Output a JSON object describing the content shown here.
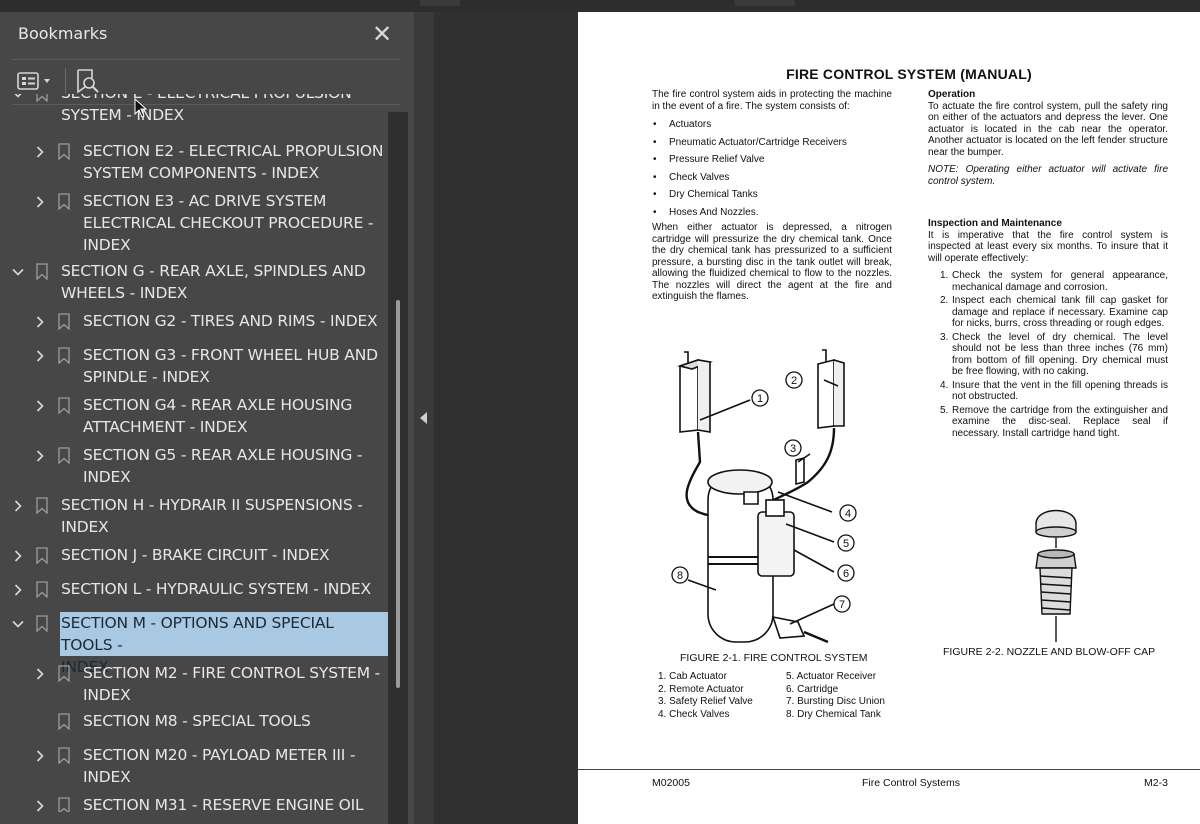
{
  "panel": {
    "title": "Bookmarks",
    "close_glyph": "✕",
    "toolbar": {
      "options_icon": "list-options-icon",
      "find_icon": "find-bookmark-icon"
    }
  },
  "bookmarks": [
    {
      "label_lines": [
        "SECTION E - ELECTRICAL PROPULSION",
        "SYSTEM - INDEX"
      ],
      "indent": 0,
      "expanded": true,
      "chevron": true,
      "clipped": true
    },
    {
      "label_lines": [
        "SECTION E2 - ELECTRICAL PROPULSION",
        "SYSTEM COMPONENTS - INDEX"
      ],
      "indent": 1,
      "expanded": false,
      "chevron": true
    },
    {
      "label_lines": [
        "SECTION E3 - AC DRIVE SYSTEM",
        "ELECTRICAL CHECKOUT PROCEDURE -",
        "INDEX"
      ],
      "indent": 1,
      "expanded": false,
      "chevron": true
    },
    {
      "label_lines": [
        "SECTION G - REAR AXLE, SPINDLES AND",
        "WHEELS - INDEX"
      ],
      "indent": 0,
      "expanded": true,
      "chevron": true
    },
    {
      "label_lines": [
        "SECTION G2 - TIRES AND RIMS - INDEX"
      ],
      "indent": 1,
      "expanded": false,
      "chevron": true
    },
    {
      "label_lines": [
        "SECTION G3 - FRONT WHEEL HUB AND",
        "SPINDLE - INDEX"
      ],
      "indent": 1,
      "expanded": false,
      "chevron": true
    },
    {
      "label_lines": [
        "SECTION G4 - REAR AXLE HOUSING",
        "ATTACHMENT - INDEX"
      ],
      "indent": 1,
      "expanded": false,
      "chevron": true
    },
    {
      "label_lines": [
        "SECTION G5 - REAR AXLE HOUSING -",
        "INDEX"
      ],
      "indent": 1,
      "expanded": false,
      "chevron": true
    },
    {
      "label_lines": [
        "SECTION H - HYDRAIR II SUSPENSIONS -",
        "INDEX"
      ],
      "indent": 0,
      "expanded": false,
      "chevron": true
    },
    {
      "label_lines": [
        "SECTION J - BRAKE CIRCUIT - INDEX"
      ],
      "indent": 0,
      "expanded": false,
      "chevron": true
    },
    {
      "label_lines": [
        "SECTION L - HYDRAULIC SYSTEM - INDEX"
      ],
      "indent": 0,
      "expanded": false,
      "chevron": true
    },
    {
      "label_lines": [
        "SECTION M - OPTIONS AND SPECIAL TOOLS -",
        "INDEX"
      ],
      "indent": 0,
      "expanded": true,
      "chevron": true,
      "selected": true
    },
    {
      "label_lines": [
        "SECTION M2 - FIRE CONTROL SYSTEM -",
        "INDEX"
      ],
      "indent": 1,
      "expanded": false,
      "chevron": true
    },
    {
      "label_lines": [
        "SECTION M8 - SPECIAL TOOLS"
      ],
      "indent": 1,
      "expanded": false,
      "chevron": false
    },
    {
      "label_lines": [
        "SECTION M20 - PAYLOAD METER III -",
        "INDEX"
      ],
      "indent": 1,
      "expanded": false,
      "chevron": true
    },
    {
      "label_lines": [
        "SECTION M31 - RESERVE ENGINE OIL"
      ],
      "indent": 1,
      "expanded": false,
      "chevron": true
    }
  ],
  "document": {
    "title": "FIRE CONTROL SYSTEM (MANUAL)",
    "intro": "The fire control system aids in protecting the machine in the event of a fire. The system consists of:",
    "components": [
      "Actuators",
      "Pneumatic Actuator/Cartridge Receivers",
      "Pressure Relief Valve",
      "Check Valves",
      "Dry Chemical Tanks",
      "Hoses And Nozzles."
    ],
    "actuation_text": "When either actuator is depressed, a nitrogen cartridge will pressurize the dry chemical tank. Once the dry chemical tank has pressurized to a sufficient pressure, a bursting disc in the tank outlet will break, allowing the fluidized chemical to flow to the nozzles. The nozzles will direct the agent at the fire and extinguish the flames.",
    "operation_heading": "Operation",
    "operation_text": "To actuate the fire control system, pull the safety ring on either of the actuators and depress the lever. One actuator is located in the cab near the operator. Another actuator is located on the left fender structure near the bumper.",
    "operation_note": "NOTE: Operating either actuator will activate fire control system.",
    "inspection_heading": "Inspection and Maintenance",
    "inspection_text": "It is imperative that the fire control system is inspected at least every six months. To insure that it will operate effectively:",
    "steps": [
      "Check the system for general appearance, mechanical damage and corrosion.",
      "Inspect each chemical tank fill cap gasket for damage and replace if necessary. Examine cap for nicks, burrs, cross threading or rough edges.",
      "Check the level of dry chemical. The level should not be less than three inches (76 mm) from bottom of fill opening. Dry chemical must be free flowing, with no caking.",
      "Insure that the vent in the fill opening threads is not obstructed.",
      "Remove the cartridge from the extinguisher and examine the disc-seal. Replace seal if necessary. Install cartridge hand tight."
    ],
    "step_numbers": [
      "1.",
      "2.",
      "3.",
      "4.",
      "5."
    ],
    "figure1_caption": "FIGURE 2-1. FIRE CONTROL SYSTEM",
    "figure1_callouts": [
      "1",
      "2",
      "3",
      "4",
      "5",
      "6",
      "7",
      "8"
    ],
    "figure1_legend_left": [
      "1. Cab Actuator",
      "2. Remote Actuator",
      "3. Safety Relief Valve",
      "4. Check Valves"
    ],
    "figure1_legend_right": [
      "5. Actuator Receiver",
      "6. Cartridge",
      "7. Bursting Disc Union",
      "8. Dry Chemical Tank"
    ],
    "figure2_caption": "FIGURE 2-2. NOZZLE AND BLOW-OFF CAP",
    "footer_left": "M02005",
    "footer_center": "Fire Control Systems",
    "footer_right": "M2-3"
  }
}
